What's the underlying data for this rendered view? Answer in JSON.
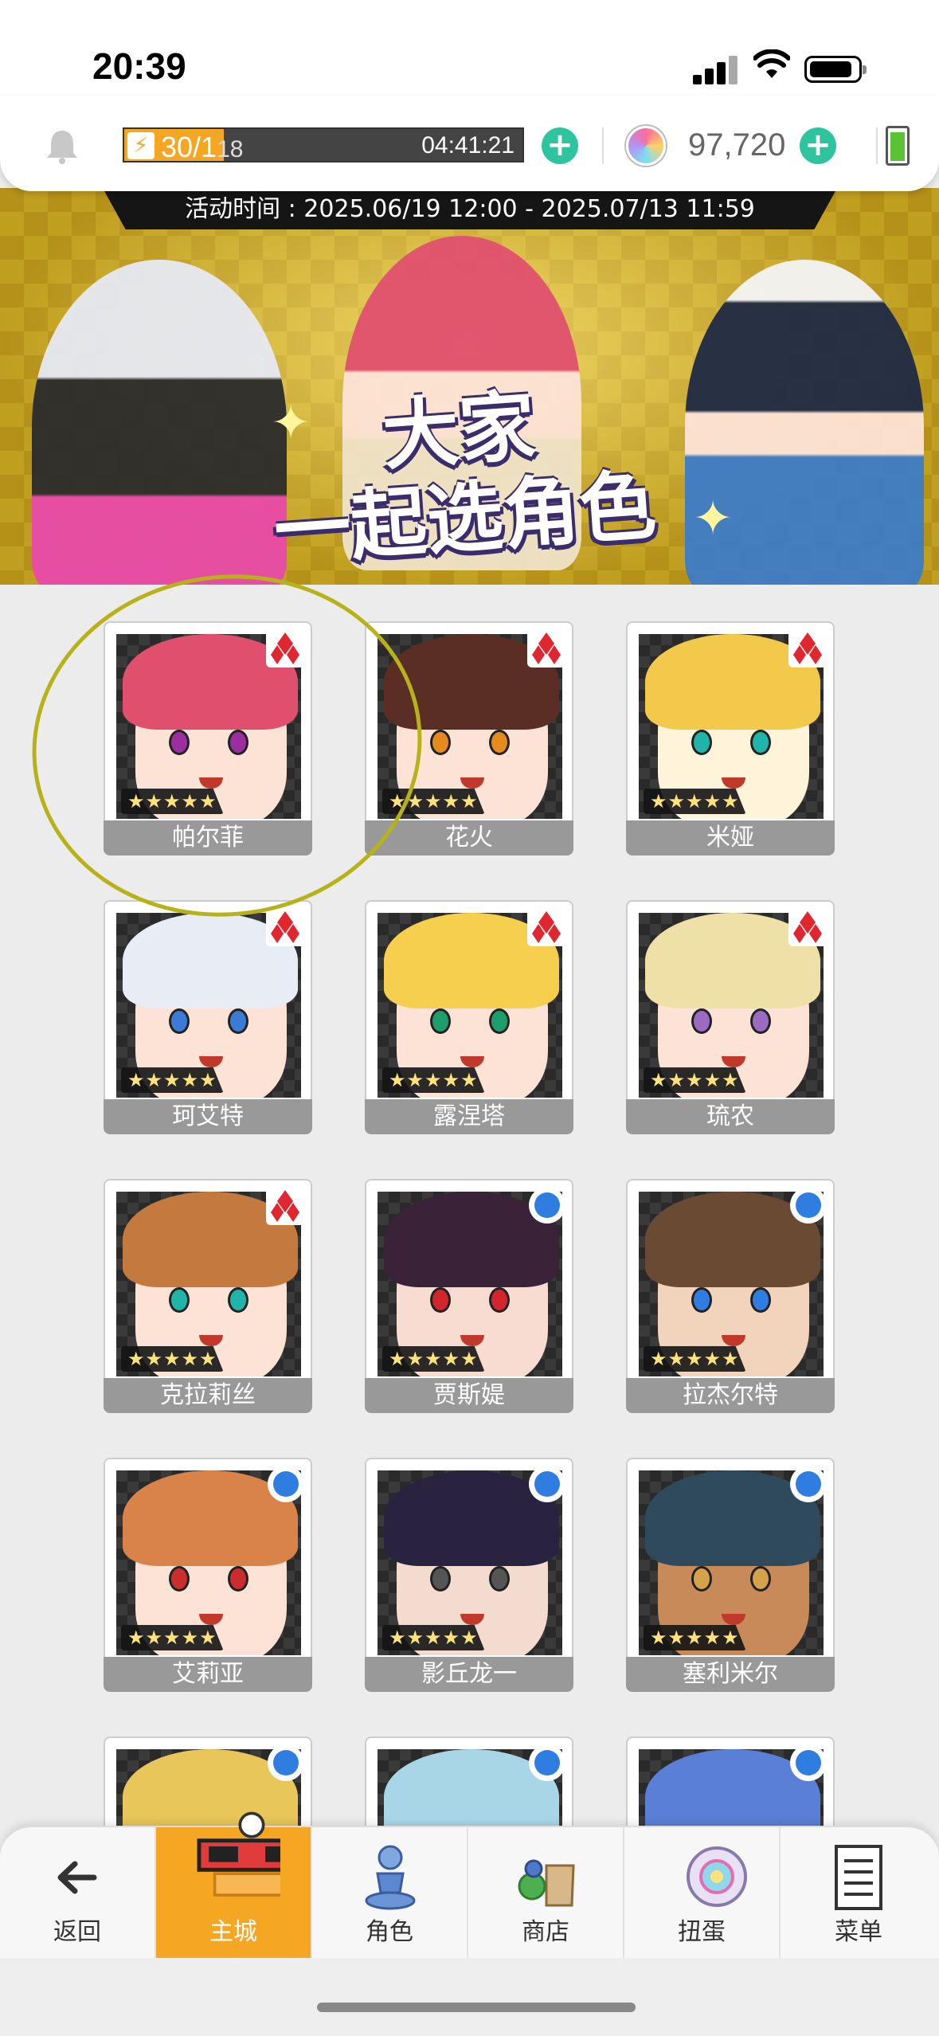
{
  "status_bar": {
    "time": "20:39"
  },
  "resources": {
    "stamina_current": "30/1",
    "stamina_max": "18",
    "stamina_fill": 0.25,
    "stamina_timer": "04:41:21",
    "gems": "97,720"
  },
  "banner": {
    "period": "活动时间 : 2025.06/19 12:00 - 2025.07/13 11:59",
    "title_line1": "大家",
    "title_line2": "一起选角色"
  },
  "characters": [
    {
      "name": "帕尔菲",
      "stars": "★★★★★",
      "attribute": "fire",
      "hair": "#e0506e",
      "skin": "#fde3d6",
      "eye": "#9b2fa0"
    },
    {
      "name": "花火",
      "stars": "★★★★★",
      "attribute": "fire",
      "hair": "#5a2e24",
      "skin": "#fde3d6",
      "eye": "#e58a1f"
    },
    {
      "name": "米娅",
      "stars": "★★★★★",
      "attribute": "fire",
      "hair": "#f3c94b",
      "skin": "#fff3da",
      "eye": "#1fb5a8"
    },
    {
      "name": "珂艾特",
      "stars": "★★★★★",
      "attribute": "fire",
      "hair": "#e8ecf5",
      "skin": "#fde3d6",
      "eye": "#3a7bd5"
    },
    {
      "name": "露涅塔",
      "stars": "★★★★★",
      "attribute": "fire",
      "hair": "#f6cf4e",
      "skin": "#fde3d6",
      "eye": "#1f9e6d"
    },
    {
      "name": "琉农",
      "stars": "★★★★★",
      "attribute": "fire",
      "hair": "#efe0a8",
      "skin": "#fde3d6",
      "eye": "#9b6ac2"
    },
    {
      "name": "克拉莉丝",
      "stars": "★★★★★",
      "attribute": "fire",
      "hair": "#c47a3e",
      "skin": "#fde3d6",
      "eye": "#1fb5a8"
    },
    {
      "name": "贾斯媞",
      "stars": "★★★★★",
      "attribute": "water",
      "hair": "#3a2238",
      "skin": "#f8dcd2",
      "eye": "#d0262c"
    },
    {
      "name": "拉杰尔特",
      "stars": "★★★★★",
      "attribute": "water",
      "hair": "#6b4a34",
      "skin": "#f2d3bb",
      "eye": "#2f7de1"
    },
    {
      "name": "艾莉亚",
      "stars": "★★★★★",
      "attribute": "water",
      "hair": "#d9824a",
      "skin": "#fde3d6",
      "eye": "#c92d2d"
    },
    {
      "name": "影丘龙一",
      "stars": "★★★★★",
      "attribute": "water",
      "hair": "#2a2340",
      "skin": "#f3dccf",
      "eye": "#555555"
    },
    {
      "name": "塞利米尔",
      "stars": "★★★★★",
      "attribute": "water",
      "hair": "#2f4a5c",
      "skin": "#c98a5a",
      "eye": "#d4a24a"
    },
    {
      "name": "",
      "stars": "",
      "attribute": "water",
      "hair": "#e8c65a",
      "skin": "#fde3d6",
      "eye": "#2f7de1"
    },
    {
      "name": "",
      "stars": "",
      "attribute": "water",
      "hair": "#a9d6e6",
      "skin": "#fde3d6",
      "eye": "#2f7de1"
    },
    {
      "name": "",
      "stars": "",
      "attribute": "water",
      "hair": "#5a7fd6",
      "skin": "#fde3d6",
      "eye": "#2f7de1"
    }
  ],
  "nav": {
    "back": "返回",
    "home": "主城",
    "characters": "角色",
    "shop": "商店",
    "gacha": "扭蛋",
    "menu": "菜单"
  },
  "colors": {
    "accent_orange": "#f5a623",
    "plus_green": "#2ec4a0",
    "fire_red": "#e0262f",
    "water_blue": "#2f7de1"
  }
}
